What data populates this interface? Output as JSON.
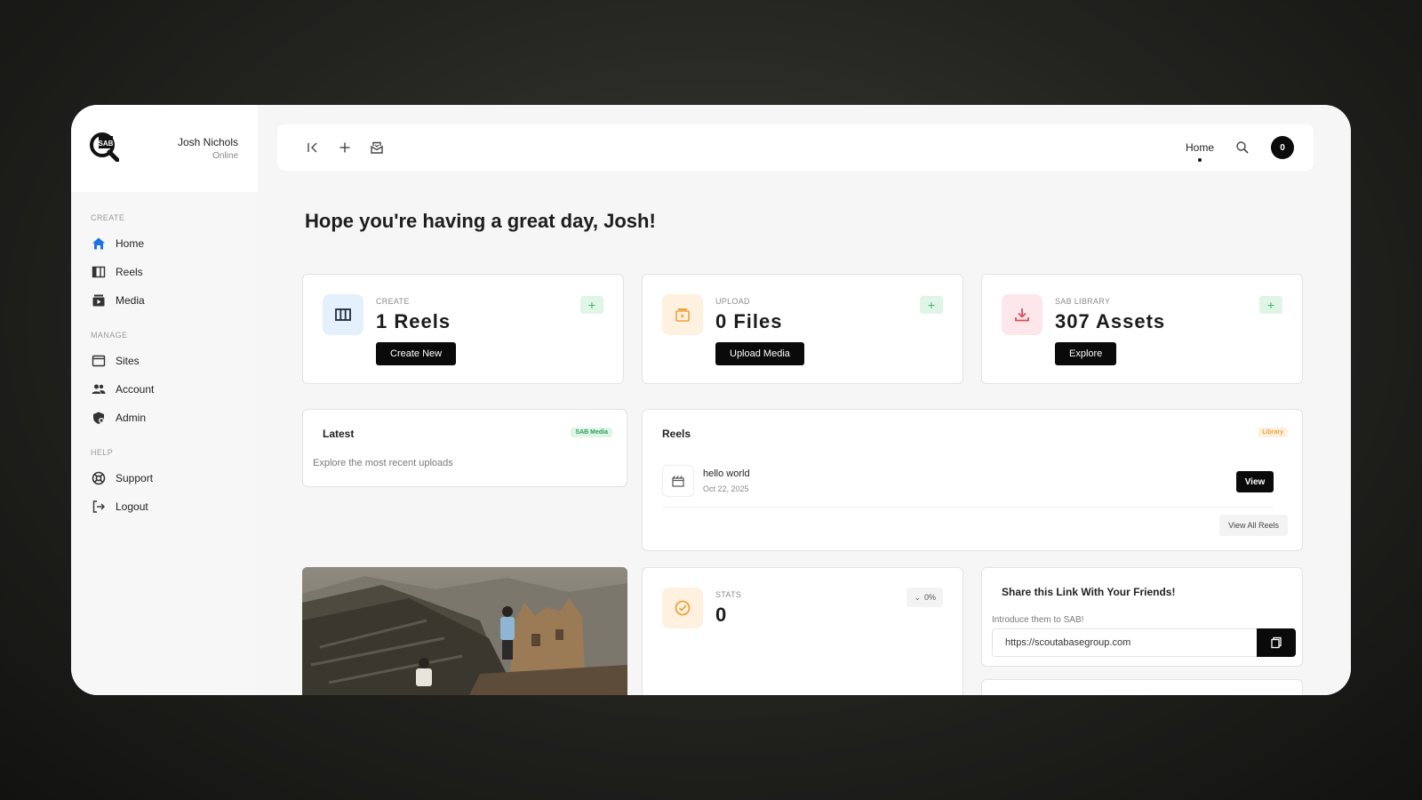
{
  "user": {
    "name": "Josh Nichols",
    "status": "Online"
  },
  "sidebar": {
    "sections": [
      {
        "label": "CREATE",
        "items": [
          {
            "label": "Home",
            "icon": "home-icon"
          },
          {
            "label": "Reels",
            "icon": "reels-icon"
          },
          {
            "label": "Media",
            "icon": "media-icon"
          }
        ]
      },
      {
        "label": "MANAGE",
        "items": [
          {
            "label": "Sites",
            "icon": "sites-icon"
          },
          {
            "label": "Account",
            "icon": "users-icon"
          },
          {
            "label": "Admin",
            "icon": "admin-icon"
          }
        ]
      },
      {
        "label": "HELP",
        "items": [
          {
            "label": "Support",
            "icon": "lifebuoy-icon"
          },
          {
            "label": "Logout",
            "icon": "logout-icon"
          }
        ]
      }
    ]
  },
  "topbar": {
    "home_label": "Home",
    "avatar_count": "0"
  },
  "greeting": "Hope you're having a great day, Josh!",
  "stats": [
    {
      "label": "CREATE",
      "value": "1 Reels",
      "button": "Create New",
      "plus": "+",
      "icon_bg": "#e4f0fc",
      "icon_color": "#1e2a3a"
    },
    {
      "label": "UPLOAD",
      "value": "0 Files",
      "button": "Upload Media",
      "plus": "+",
      "icon_bg": "#fff1e0",
      "icon_color": "#f0a13a"
    },
    {
      "label": "SAB LIBRARY",
      "value": "307 Assets",
      "button": "Explore",
      "plus": "+",
      "icon_bg": "#fde7ea",
      "icon_color": "#e04a5a"
    }
  ],
  "latest": {
    "title": "Latest",
    "badge": "SAB Media",
    "description": "Explore the most recent uploads"
  },
  "reels": {
    "title": "Reels",
    "badge": "Library",
    "items": [
      {
        "title": "hello world",
        "date": "Oct 22, 2025",
        "button": "View"
      }
    ],
    "view_all": "View All Reels"
  },
  "stats_card": {
    "label": "STATS",
    "value": "0",
    "trend": "0%"
  },
  "share": {
    "title": "Share this Link With Your Friends!",
    "intro": "Introduce them to SAB!",
    "url": "https://scoutabasegroup.com"
  }
}
